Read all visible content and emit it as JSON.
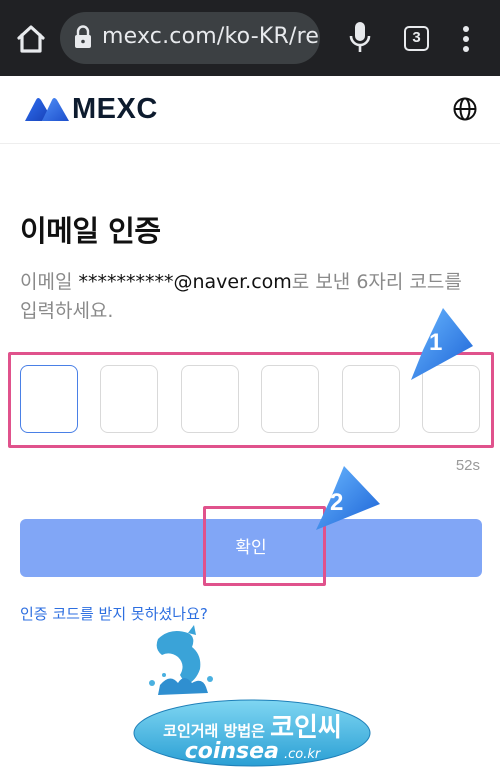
{
  "browser": {
    "url": "mexc.com/ko-KR/reg",
    "tab_count": "3",
    "icons": [
      "home-icon",
      "lock-icon",
      "mic-icon",
      "tabs-icon",
      "menu-icon"
    ]
  },
  "header": {
    "logo_text": "MEXC",
    "icons": [
      "mexc-logo-icon",
      "globe-icon"
    ]
  },
  "main": {
    "title": "이메일 인증",
    "desc_prefix": "이메일 ",
    "email": "**********@naver.com",
    "desc_suffix": "로 보낸 6자리 코드를 입력하세요.",
    "code_boxes": 6,
    "timer": "52s",
    "confirm_label": "확인",
    "resend_label": "인증 코드를 받지 못하셨나요?"
  },
  "annotations": {
    "step1": "1",
    "step2": "2"
  },
  "watermark": {
    "line1": "코인거래 방법은",
    "brand_ko": "코인씨",
    "brand_en": "coinsea",
    "domain_suffix": ".co.kr"
  },
  "colors": {
    "chrome_bg": "#202124",
    "primary_button": "#81a6f6",
    "link": "#2e6fe0",
    "highlight": "#e0528c",
    "active_border": "#4a80e6"
  }
}
